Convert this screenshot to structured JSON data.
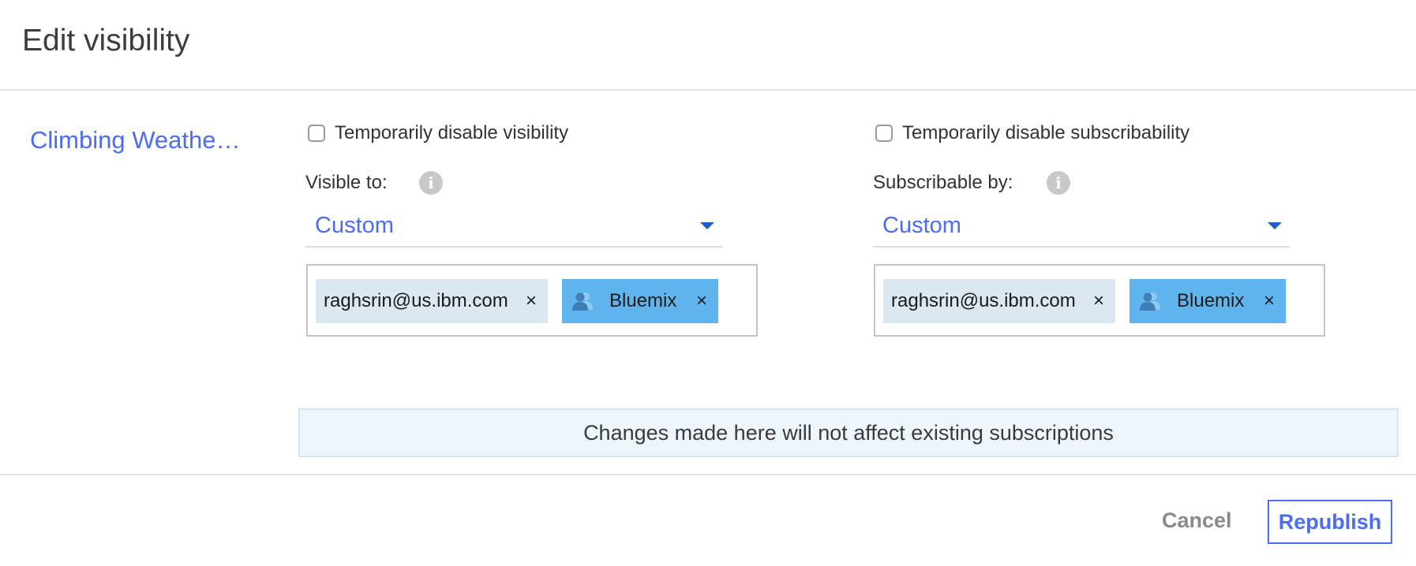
{
  "dialog": {
    "title": "Edit visibility",
    "api_name": "Climbing Weathe…"
  },
  "visibility": {
    "disable_label": "Temporarily disable visibility",
    "field_label": "Visible to:",
    "selected": "Custom",
    "tags": [
      {
        "label": "raghsrin@us.ibm.com",
        "type": "user"
      },
      {
        "label": "Bluemix",
        "type": "group"
      }
    ]
  },
  "subscribability": {
    "disable_label": "Temporarily disable subscribability",
    "field_label": "Subscribable by:",
    "selected": "Custom",
    "tags": [
      {
        "label": "raghsrin@us.ibm.com",
        "type": "user"
      },
      {
        "label": "Bluemix",
        "type": "group"
      }
    ]
  },
  "notice": "Changes made here will not affect existing subscriptions",
  "footer": {
    "cancel_label": "Cancel",
    "republish_label": "Republish"
  },
  "icons": {
    "info": "info-icon",
    "caret": "caret-down-icon",
    "remove": "close-icon",
    "group": "group-icon"
  },
  "glyphs": {
    "info": "i",
    "remove": "×"
  },
  "colors": {
    "accent": "#4a6cf7",
    "user_tag": "#dbe8f2",
    "group_tag": "#5fb4ee",
    "notice_bg": "#eef6fb"
  }
}
